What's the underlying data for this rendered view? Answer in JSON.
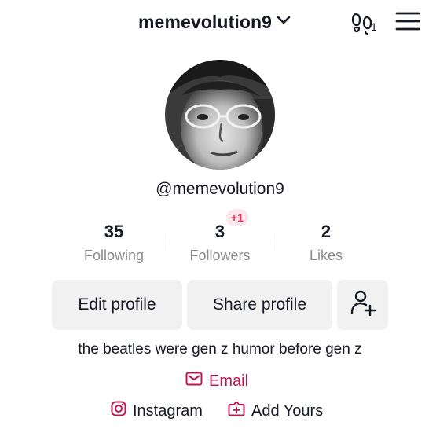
{
  "header": {
    "username": "memevolution9",
    "footprint_count": "1"
  },
  "profile": {
    "handle": "@memevolution9",
    "bio": "the beatles were gen z humor before gen z"
  },
  "stats": [
    {
      "value": "35",
      "label": "Following"
    },
    {
      "value": "3",
      "label": "Followers",
      "badge": "+1"
    },
    {
      "value": "2",
      "label": "Likes"
    }
  ],
  "actions": {
    "edit": "Edit profile",
    "share": "Share profile"
  },
  "links": {
    "email": "Email",
    "instagram": "Instagram",
    "add_yours": "Add Yours"
  },
  "colors": {
    "accent": "#fe2c55",
    "email_link": "#c0174f",
    "button_bg": "#f1f1f2",
    "muted_text": "#8a8b91"
  }
}
